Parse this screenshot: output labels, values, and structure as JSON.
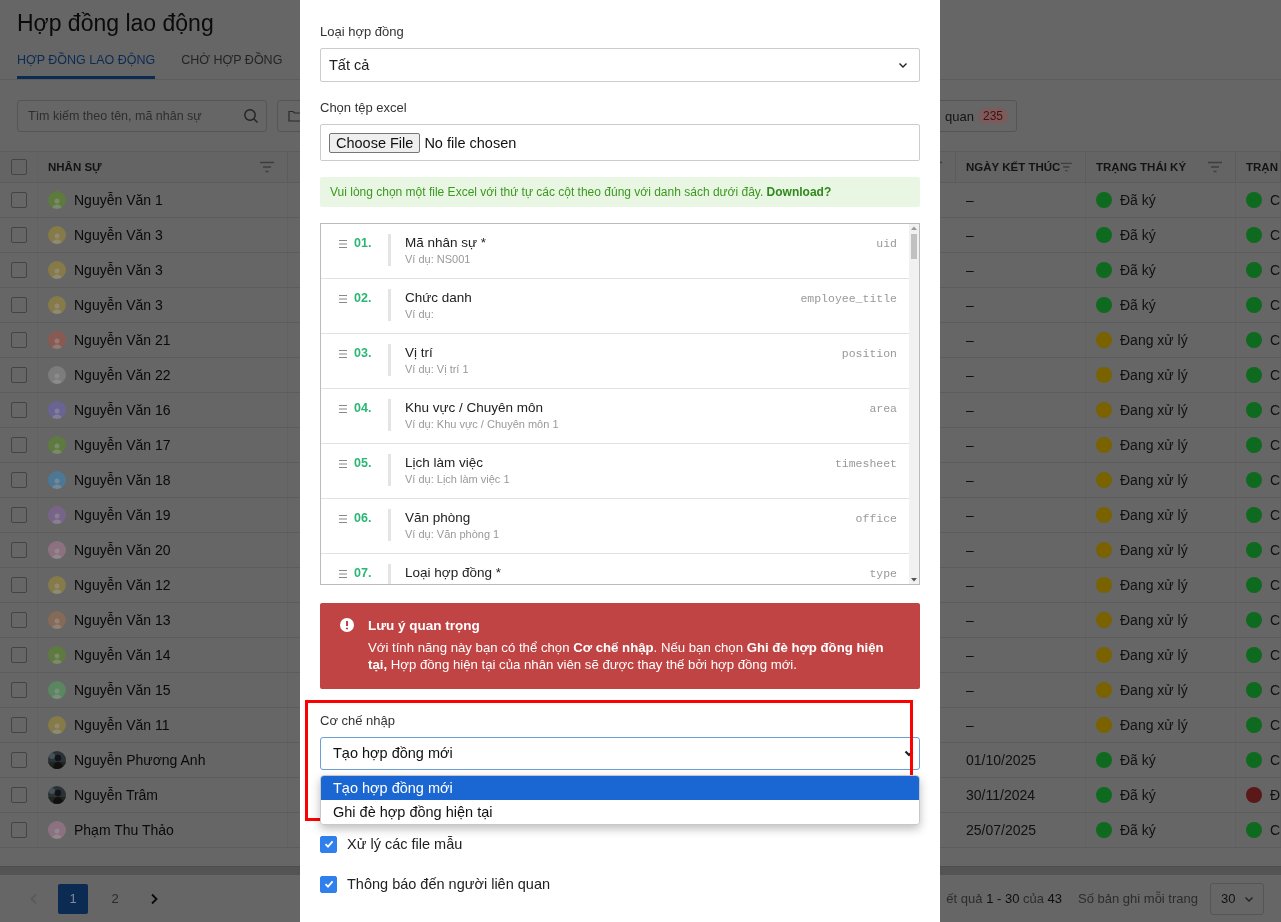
{
  "page": {
    "title": "Hợp đồng lao động"
  },
  "tabs": [
    {
      "label": "HỢP ĐỒNG LAO ĐỘNG",
      "selected": true
    },
    {
      "label": "CHỜ HỢP ĐỒNG",
      "selected": false
    }
  ],
  "toolbar": {
    "search_placeholder": "Tìm kiếm theo tên, mã nhân sự",
    "related_button": {
      "label": "quan",
      "count": "235"
    }
  },
  "table": {
    "select_all_checked": false,
    "columns": [
      {
        "label": "NHÂN SỰ"
      },
      {
        "label": "NGÀY KẾT THÚC"
      },
      {
        "label": "TRẠNG THÁI KÝ"
      },
      {
        "label": "TRẠN"
      }
    ],
    "rows": [
      {
        "checked": false,
        "name": "Nguyễn Văn 1",
        "avatar": {
          "kind": "placeholder",
          "color": "#5e7a3e"
        },
        "end": "–",
        "sign": {
          "text": "Đã ký",
          "color": "#0e6a1e"
        },
        "state": {
          "text": "C",
          "color": "#0e6a1e"
        }
      },
      {
        "checked": false,
        "name": "Nguyễn Văn 3",
        "avatar": {
          "kind": "placeholder",
          "color": "#857a48"
        },
        "end": "–",
        "sign": {
          "text": "Đã ký",
          "color": "#0e6a1e"
        },
        "state": {
          "text": "C",
          "color": "#0e6a1e"
        }
      },
      {
        "checked": false,
        "name": "Nguyễn Văn 3",
        "avatar": {
          "kind": "placeholder",
          "color": "#857a48"
        },
        "end": "–",
        "sign": {
          "text": "Đã ký",
          "color": "#0e6a1e"
        },
        "state": {
          "text": "C",
          "color": "#0e6a1e"
        }
      },
      {
        "checked": false,
        "name": "Nguyễn Văn 3",
        "avatar": {
          "kind": "placeholder",
          "color": "#857a48"
        },
        "end": "–",
        "sign": {
          "text": "Đã ký",
          "color": "#0e6a1e"
        },
        "state": {
          "text": "C",
          "color": "#0e6a1e"
        }
      },
      {
        "checked": false,
        "name": "Nguyễn Văn 21",
        "avatar": {
          "kind": "placeholder",
          "color": "#8a5a52"
        },
        "end": "–",
        "sign": {
          "text": "Đang xử lý",
          "color": "#7a6200"
        },
        "state": {
          "text": "C",
          "color": "#0e6a1e"
        }
      },
      {
        "checked": false,
        "name": "Nguyễn Văn 22",
        "avatar": {
          "kind": "placeholder",
          "color": "#7c7c7c"
        },
        "end": "–",
        "sign": {
          "text": "Đang xử lý",
          "color": "#7a6200"
        },
        "state": {
          "text": "C",
          "color": "#0e6a1e"
        }
      },
      {
        "checked": false,
        "name": "Nguyễn Văn 16",
        "avatar": {
          "kind": "placeholder",
          "color": "#686494"
        },
        "end": "–",
        "sign": {
          "text": "Đang xử lý",
          "color": "#7a6200"
        },
        "state": {
          "text": "C",
          "color": "#0e6a1e"
        }
      },
      {
        "checked": false,
        "name": "Nguyễn Văn 17",
        "avatar": {
          "kind": "placeholder",
          "color": "#5e7a3e"
        },
        "end": "–",
        "sign": {
          "text": "Đang xử lý",
          "color": "#7a6200"
        },
        "state": {
          "text": "C",
          "color": "#0e6a1e"
        }
      },
      {
        "checked": false,
        "name": "Nguyễn Văn 18",
        "avatar": {
          "kind": "placeholder",
          "color": "#4c7896"
        },
        "end": "–",
        "sign": {
          "text": "Đang xử lý",
          "color": "#7a6200"
        },
        "state": {
          "text": "C",
          "color": "#0e6a1e"
        }
      },
      {
        "checked": false,
        "name": "Nguyễn Văn 19",
        "avatar": {
          "kind": "placeholder",
          "color": "#786489"
        },
        "end": "–",
        "sign": {
          "text": "Đang xử lý",
          "color": "#7a6200"
        },
        "state": {
          "text": "C",
          "color": "#0e6a1e"
        }
      },
      {
        "checked": false,
        "name": "Nguyễn Văn 20",
        "avatar": {
          "kind": "placeholder",
          "color": "#8c7280"
        },
        "end": "–",
        "sign": {
          "text": "Đang xử lý",
          "color": "#7a6200"
        },
        "state": {
          "text": "C",
          "color": "#0e6a1e"
        }
      },
      {
        "checked": false,
        "name": "Nguyễn Văn 12",
        "avatar": {
          "kind": "placeholder",
          "color": "#857a48"
        },
        "end": "–",
        "sign": {
          "text": "Đang xử lý",
          "color": "#7a6200"
        },
        "state": {
          "text": "C",
          "color": "#0e6a1e"
        }
      },
      {
        "checked": false,
        "name": "Nguyễn Văn 13",
        "avatar": {
          "kind": "placeholder",
          "color": "#866a58"
        },
        "end": "–",
        "sign": {
          "text": "Đang xử lý",
          "color": "#7a6200"
        },
        "state": {
          "text": "C",
          "color": "#0e6a1e"
        }
      },
      {
        "checked": false,
        "name": "Nguyễn Văn 14",
        "avatar": {
          "kind": "placeholder",
          "color": "#5e7a3e"
        },
        "end": "–",
        "sign": {
          "text": "Đang xử lý",
          "color": "#7a6200"
        },
        "state": {
          "text": "C",
          "color": "#0e6a1e"
        }
      },
      {
        "checked": false,
        "name": "Nguyễn Văn 15",
        "avatar": {
          "kind": "placeholder",
          "color": "#5a8660"
        },
        "end": "–",
        "sign": {
          "text": "Đang xử lý",
          "color": "#7a6200"
        },
        "state": {
          "text": "C",
          "color": "#0e6a1e"
        }
      },
      {
        "checked": false,
        "name": "Nguyễn Văn 11",
        "avatar": {
          "kind": "placeholder",
          "color": "#857a48"
        },
        "end": "–",
        "sign": {
          "text": "Đang xử lý",
          "color": "#7a6200"
        },
        "state": {
          "text": "C",
          "color": "#0e6a1e"
        }
      },
      {
        "checked": false,
        "name": "Nguyễn Phương Anh",
        "end": "01/10/2025",
        "sign": {
          "text": "Đã ký",
          "color": "#0e6a1e"
        },
        "state": {
          "text": "C",
          "color": "#0e6a1e"
        }
      },
      {
        "checked": false,
        "name": "Nguyễn Trâm",
        "end": "30/11/2024",
        "sign": {
          "text": "Đã ký",
          "color": "#0e6a1e"
        },
        "state": {
          "text": "Đ",
          "color": "#5a1818"
        }
      },
      {
        "checked": false,
        "name": "Phạm Thu Thảo",
        "avatar": {
          "kind": "placeholder",
          "color": "#8c7280"
        },
        "end": "25/07/2025",
        "sign": {
          "text": "Đã ký",
          "color": "#0e6a1e"
        },
        "state": {
          "text": "C",
          "color": "#0e6a1e"
        }
      }
    ]
  },
  "pagination": {
    "pages": [
      {
        "label": "1",
        "selected": true
      },
      {
        "label": "2",
        "selected": false
      }
    ],
    "prev_disabled": true,
    "next_disabled": false,
    "summary": "ết quả **1 - 30** của **43**",
    "page_size_label": "Số bản ghi mỗi trang",
    "page_size": "30"
  },
  "modal": {
    "contract_type": {
      "label": "Loại hợp đồng",
      "value": "Tất cả"
    },
    "file": {
      "label": "Chọn tệp excel",
      "button": "Choose File",
      "status": "No file chosen"
    },
    "note": {
      "text": "Vui lòng chọn một file Excel với thứ tự các cột theo đúng với danh sách dưới đây.",
      "link": "Download?"
    },
    "columns": [
      {
        "number": "01.",
        "title": "Mã nhân sự *",
        "example": "Ví dụ: NS001",
        "key": "uid"
      },
      {
        "number": "02.",
        "title": "Chức danh",
        "example": "Ví dụ:",
        "key": "employee_title"
      },
      {
        "number": "03.",
        "title": "Vị trí",
        "example": "Ví dụ: Vị trí 1",
        "key": "position"
      },
      {
        "number": "04.",
        "title": "Khu vực / Chuyên môn",
        "example": "Ví dụ: Khu vực / Chuyên môn 1",
        "key": "area"
      },
      {
        "number": "05.",
        "title": "Lịch làm việc",
        "example": "Ví dụ: Lịch làm việc 1",
        "key": "timesheet"
      },
      {
        "number": "06.",
        "title": "Văn phòng",
        "example": "Ví dụ: Văn phòng 1",
        "key": "office"
      },
      {
        "number": "07.",
        "title": "Loại hợp đồng *",
        "key": "type"
      }
    ],
    "alert": {
      "title": "Lưu ý quan trọng",
      "text": "Với tính năng này bạn có thể chọn **Cơ chế nhập**. Nếu bạn chọn **Ghi đè hợp đồng hiện tại,** Hợp đồng hiện tại của nhân viên sẽ được thay thế bởi hợp đồng mới."
    },
    "import_mode": {
      "label": "Cơ chế nhập",
      "value": "Tạo hợp đồng mới",
      "expanded": true,
      "options": [
        {
          "label": "Tạo hợp đồng mới",
          "selected": true
        },
        {
          "label": "Ghi đè hợp đồng hiện tại",
          "selected": false
        }
      ]
    },
    "options": [
      {
        "label": "Xử lý các file mẫu",
        "checked": true
      },
      {
        "label": "Thông báo đến người liên quan",
        "checked": true
      }
    ]
  }
}
